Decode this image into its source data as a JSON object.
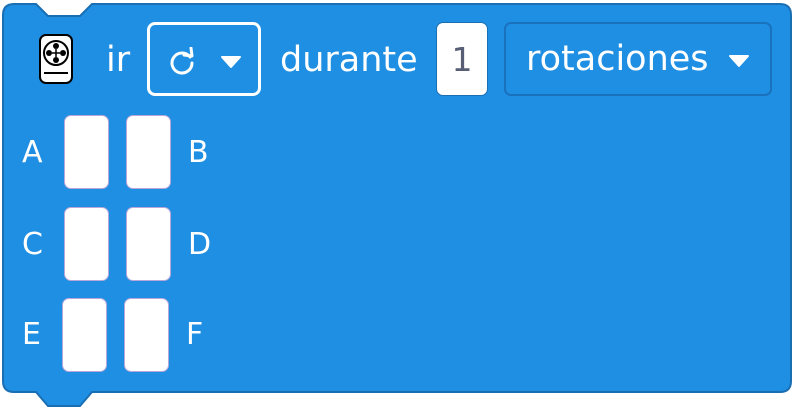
{
  "block": {
    "label_go": "ir",
    "direction_icon": "rotate-clockwise-icon",
    "label_during": "durante",
    "duration_value": "1",
    "unit_selected": "rotaciones",
    "motor_icon": "motor-icon",
    "ports": [
      "A",
      "B",
      "C",
      "D",
      "E",
      "F"
    ],
    "colors": {
      "block_fill": "#1f8fe3",
      "block_border": "#1a6fb3",
      "text": "#ffffff",
      "input_text": "#575e75"
    }
  }
}
